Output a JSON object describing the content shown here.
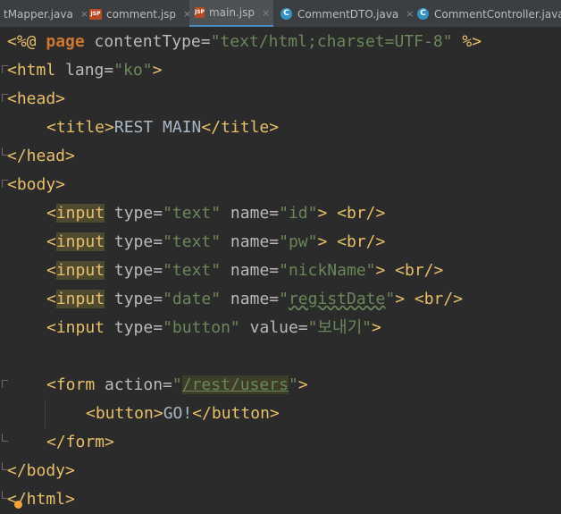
{
  "tabs": [
    {
      "label": "tMapper.java",
      "icon": "none",
      "active": false
    },
    {
      "label": "comment.jsp",
      "icon": "jsp-file-icon",
      "active": false
    },
    {
      "label": "main.jsp",
      "icon": "jsp-file-icon",
      "active": true
    },
    {
      "label": "CommentDTO.java",
      "icon": "class-file-icon",
      "active": false
    },
    {
      "label": "CommentController.java",
      "icon": "class-file-icon",
      "active": false
    }
  ],
  "close_glyph": "×",
  "jsp_badge": "JSP",
  "class_badge": "C",
  "code": {
    "l1": {
      "a": "<%@ ",
      "b": "page",
      "c": " contentType=",
      "d": "\"text/html;charset=UTF-8\"",
      "e": " %>"
    },
    "l2": {
      "a": "<html",
      "b": " lang=",
      "c": "\"ko\"",
      "d": ">"
    },
    "l3": {
      "a": "<head>"
    },
    "l4": {
      "a": "<title>",
      "b": "REST MAIN",
      "c": "</title>"
    },
    "l5": {
      "a": "</head>"
    },
    "l6": {
      "a": "<body>"
    },
    "l7": {
      "a": "<",
      "b": "input",
      "c": " type=",
      "d": "\"text\"",
      "e": " name=",
      "f": "\"id\"",
      "g": "> <br/>"
    },
    "l8": {
      "a": "<",
      "b": "input",
      "c": " type=",
      "d": "\"text\"",
      "e": " name=",
      "f": "\"pw\"",
      "g": "> <br/>"
    },
    "l9": {
      "a": "<",
      "b": "input",
      "c": " type=",
      "d": "\"text\"",
      "e": " name=",
      "f": "\"nickName\"",
      "g": "> <br/>"
    },
    "l10": {
      "a": "<",
      "b": "input",
      "c": " type=",
      "d": "\"date\"",
      "e": " name=",
      "f1": "\"",
      "f2": "registDate",
      "f3": "\"",
      "g": "> <br/>"
    },
    "l11": {
      "a": "<input",
      "b": " type=",
      "c": "\"button\"",
      "d": " value=",
      "e": "\"보내기\"",
      "f": ">"
    },
    "l12": {
      "a": "<form",
      "b": " action=",
      "c1": "\"",
      "c2": "/rest/users",
      "c3": "\"",
      "d": ">"
    },
    "l13": {
      "a": "<button>",
      "b": "GO!",
      "c": "</button>"
    },
    "l14": {
      "a": "</form>"
    },
    "l15": {
      "a": "</body>"
    },
    "l16": {
      "a": "</html>"
    }
  }
}
